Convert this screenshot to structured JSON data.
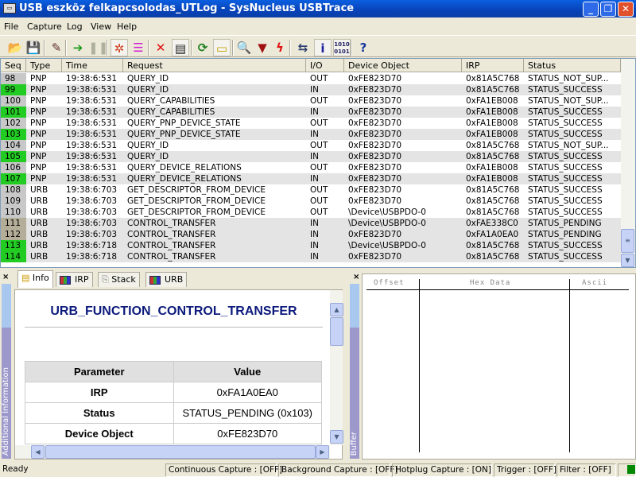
{
  "window": {
    "title": "USB eszköz felkapcsolodas_UTLog - SysNucleus USBTrace",
    "minimize": "_",
    "maximize": "❐",
    "close": "✕"
  },
  "menu": [
    "File",
    "Capture",
    "Log",
    "View",
    "Help"
  ],
  "toolbar": [
    {
      "icon": "open-folder-icon",
      "glyph": "📂",
      "color": "#d8a000"
    },
    {
      "icon": "save-icon",
      "glyph": "💾",
      "color": "#203080"
    },
    {
      "icon": "device-filter-icon",
      "glyph": "✎",
      "color": "#603030"
    },
    {
      "icon": "start-capture-icon",
      "glyph": "➔",
      "color": "#1a9a1a"
    },
    {
      "icon": "pause-capture-icon",
      "glyph": "❚❚",
      "color": "#b0b0a0"
    },
    {
      "icon": "auto-scroll-icon",
      "glyph": "✲",
      "color": "#d04020"
    },
    {
      "icon": "tree-view-icon",
      "glyph": "☰",
      "color": "#d020d0"
    },
    {
      "icon": "clear-log-icon",
      "glyph": "✕",
      "color": "#e01010"
    },
    {
      "icon": "list-view-icon",
      "glyph": "▤",
      "color": "#202020"
    },
    {
      "icon": "refresh-icon",
      "glyph": "⟳",
      "color": "#208020"
    },
    {
      "icon": "comment-icon",
      "glyph": "▭",
      "color": "#c0a000"
    },
    {
      "icon": "search-icon",
      "glyph": "🔍",
      "color": "#3090c0"
    },
    {
      "icon": "filter-icon",
      "glyph": "▼",
      "color": "#a01010"
    },
    {
      "icon": "trigger-icon",
      "glyph": "ϟ",
      "color": "#e01010"
    },
    {
      "icon": "usb-icon",
      "glyph": "⇆",
      "color": "#304070"
    },
    {
      "icon": "info-icon",
      "glyph": "i",
      "color": "#2020a0"
    },
    {
      "icon": "binary-icon",
      "glyph": "1010",
      "color": "#202060"
    },
    {
      "icon": "help-icon",
      "glyph": "?",
      "color": "#1a3aa0"
    }
  ],
  "columns": [
    "Seq",
    "Type",
    "Time",
    "Request",
    "I/O",
    "Device Object",
    "IRP",
    "Status"
  ],
  "rows": [
    {
      "seq": "98",
      "type": "PNP",
      "time": "19:38:6:531",
      "request": "QUERY_ID",
      "io": "OUT",
      "device": "0xFE823D70",
      "irp": "0x81A5C768",
      "status": "STATUS_NOT_SUP...",
      "state": "out"
    },
    {
      "seq": "99",
      "type": "PNP",
      "time": "19:38:6:531",
      "request": "QUERY_ID",
      "io": "IN",
      "device": "0xFE823D70",
      "irp": "0x81A5C768",
      "status": "STATUS_SUCCESS",
      "state": "ok"
    },
    {
      "seq": "100",
      "type": "PNP",
      "time": "19:38:6:531",
      "request": "QUERY_CAPABILITIES",
      "io": "OUT",
      "device": "0xFE823D70",
      "irp": "0xFA1EB008",
      "status": "STATUS_NOT_SUP...",
      "state": "out"
    },
    {
      "seq": "101",
      "type": "PNP",
      "time": "19:38:6:531",
      "request": "QUERY_CAPABILITIES",
      "io": "IN",
      "device": "0xFE823D70",
      "irp": "0xFA1EB008",
      "status": "STATUS_SUCCESS",
      "state": "ok"
    },
    {
      "seq": "102",
      "type": "PNP",
      "time": "19:38:6:531",
      "request": "QUERY_PNP_DEVICE_STATE",
      "io": "OUT",
      "device": "0xFE823D70",
      "irp": "0xFA1EB008",
      "status": "STATUS_SUCCESS",
      "state": "out"
    },
    {
      "seq": "103",
      "type": "PNP",
      "time": "19:38:6:531",
      "request": "QUERY_PNP_DEVICE_STATE",
      "io": "IN",
      "device": "0xFE823D70",
      "irp": "0xFA1EB008",
      "status": "STATUS_SUCCESS",
      "state": "ok"
    },
    {
      "seq": "104",
      "type": "PNP",
      "time": "19:38:6:531",
      "request": "QUERY_ID",
      "io": "OUT",
      "device": "0xFE823D70",
      "irp": "0x81A5C768",
      "status": "STATUS_NOT_SUP...",
      "state": "out"
    },
    {
      "seq": "105",
      "type": "PNP",
      "time": "19:38:6:531",
      "request": "QUERY_ID",
      "io": "IN",
      "device": "0xFE823D70",
      "irp": "0x81A5C768",
      "status": "STATUS_SUCCESS",
      "state": "ok"
    },
    {
      "seq": "106",
      "type": "PNP",
      "time": "19:38:6:531",
      "request": "QUERY_DEVICE_RELATIONS",
      "io": "OUT",
      "device": "0xFE823D70",
      "irp": "0xFA1EB008",
      "status": "STATUS_SUCCESS",
      "state": "out"
    },
    {
      "seq": "107",
      "type": "PNP",
      "time": "19:38:6:531",
      "request": "QUERY_DEVICE_RELATIONS",
      "io": "IN",
      "device": "0xFE823D70",
      "irp": "0xFA1EB008",
      "status": "STATUS_SUCCESS",
      "state": "ok"
    },
    {
      "seq": "108",
      "type": "URB",
      "time": "19:38:6:703",
      "request": "GET_DESCRIPTOR_FROM_DEVICE",
      "io": "OUT",
      "device": "0xFE823D70",
      "irp": "0x81A5C768",
      "status": "STATUS_SUCCESS",
      "state": "out"
    },
    {
      "seq": "109",
      "type": "URB",
      "time": "19:38:6:703",
      "request": "GET_DESCRIPTOR_FROM_DEVICE",
      "io": "OUT",
      "device": "0xFE823D70",
      "irp": "0x81A5C768",
      "status": "STATUS_SUCCESS",
      "state": "out"
    },
    {
      "seq": "110",
      "type": "URB",
      "time": "19:38:6:703",
      "request": "GET_DESCRIPTOR_FROM_DEVICE",
      "io": "OUT",
      "device": "\\Device\\USBPDO-0",
      "irp": "0x81A5C768",
      "status": "STATUS_SUCCESS",
      "state": "out"
    },
    {
      "seq": "111",
      "type": "URB",
      "time": "19:38:6:703",
      "request": "CONTROL_TRANSFER",
      "io": "IN",
      "device": "\\Device\\USBPDO-0",
      "irp": "0xFAE338C0",
      "status": "STATUS_PENDING",
      "state": "pending"
    },
    {
      "seq": "112",
      "type": "URB",
      "time": "19:38:6:703",
      "request": "CONTROL_TRANSFER",
      "io": "IN",
      "device": "0xFE823D70",
      "irp": "0xFA1A0EA0",
      "status": "STATUS_PENDING",
      "state": "pending"
    },
    {
      "seq": "113",
      "type": "URB",
      "time": "19:38:6:718",
      "request": "CONTROL_TRANSFER",
      "io": "IN",
      "device": "\\Device\\USBPDO-0",
      "irp": "0x81A5C768",
      "status": "STATUS_SUCCESS",
      "state": "ok"
    },
    {
      "seq": "114",
      "type": "URB",
      "time": "19:38:6:718",
      "request": "CONTROL_TRANSFER",
      "io": "IN",
      "device": "0xFE823D70",
      "irp": "0x81A5C768",
      "status": "STATUS_SUCCESS",
      "state": "ok"
    }
  ],
  "seq_colors": {
    "out": "#c8c8c8",
    "ok": "#22cc22",
    "pending": "#b4ae98"
  },
  "info_panel": {
    "side_label": "Additional Information",
    "tabs": [
      "Info",
      "IRP",
      "Stack",
      "URB"
    ],
    "title": "URB_FUNCTION_CONTROL_TRANSFER",
    "table_headers": [
      "Parameter",
      "Value"
    ],
    "params": [
      [
        "IRP",
        "0xFA1A0EA0"
      ],
      [
        "Status",
        "STATUS_PENDING (0x103)"
      ],
      [
        "Device Object",
        "0xFE823D70"
      ]
    ]
  },
  "buffer_panel": {
    "side_label": "Buffer",
    "headers": [
      "Offset",
      "Hex Data",
      "Ascii"
    ]
  },
  "statusbar": {
    "ready": "Ready",
    "continuous": "Continuous Capture : [OFF]",
    "background": "Background Capture : [OFF]",
    "hotplug": "Hotplug Capture : [ON]",
    "trigger": "Trigger : [OFF]",
    "filter": "Filter  :  [OFF]",
    "indicator_color": "#008800"
  }
}
